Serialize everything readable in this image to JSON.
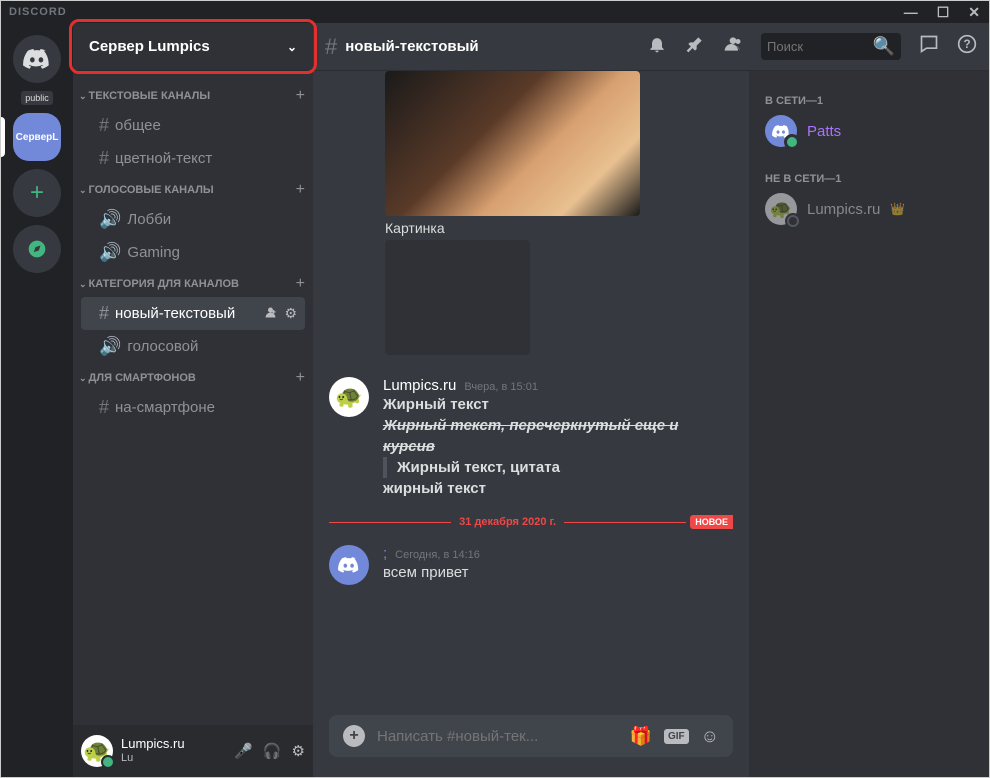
{
  "app": {
    "brand": "DISCORD"
  },
  "win_controls": {
    "minimize": "—",
    "maximize": "☐",
    "close": "✕"
  },
  "servers": {
    "public_tag": "public",
    "server_abbrev": "СерверL",
    "add": "+"
  },
  "server_header": {
    "name": "Сервер Lumpics"
  },
  "categories": [
    {
      "label": "ТЕКСТОВЫЕ КАНАЛЫ",
      "channels": [
        {
          "name": "общее",
          "type": "text"
        },
        {
          "name": "цветной-текст",
          "type": "text"
        }
      ]
    },
    {
      "label": "ГОЛОСОВЫЕ КАНАЛЫ",
      "channels": [
        {
          "name": "Лобби",
          "type": "voice"
        },
        {
          "name": "Gaming",
          "type": "voice"
        }
      ]
    },
    {
      "label": "КАТЕГОРИЯ ДЛЯ КАНАЛОВ",
      "channels": [
        {
          "name": "новый-текстовый",
          "type": "text",
          "active": true
        },
        {
          "name": "голосовой",
          "type": "voice"
        }
      ]
    },
    {
      "label": "ДЛЯ СМАРТФОНОВ",
      "channels": [
        {
          "name": "на-смартфоне",
          "type": "text"
        }
      ]
    }
  ],
  "user_panel": {
    "name": "Lumpics.ru",
    "sub": "Lu"
  },
  "chat_header": {
    "channel": "новый-текстовый",
    "search_placeholder": "Поиск"
  },
  "messages": {
    "attachment_label": "Картинка",
    "m1": {
      "author": "Lumpics.ru",
      "time": "Вчера, в 15:01",
      "l1": "Жирный текст",
      "l2": "Жирный текст, перечеркнутый еще и курсив",
      "l3": "Жирный текст, цитата",
      "l4": "жирный текст"
    },
    "divider": {
      "date": "31 декабря 2020 г.",
      "new": "НОВОЕ"
    },
    "m2": {
      "author": ";",
      "time": "Сегодня, в 14:16",
      "text": "всем привет"
    }
  },
  "compose": {
    "placeholder": "Написать #новый-тек...",
    "gif": "GIF"
  },
  "members": {
    "online_label": "В СЕТИ—1",
    "offline_label": "НЕ В СЕТИ—1",
    "online": [
      {
        "name": "Patts",
        "color": "#a973ff"
      }
    ],
    "offline": [
      {
        "name": "Lumpics.ru",
        "crown": true
      }
    ]
  }
}
